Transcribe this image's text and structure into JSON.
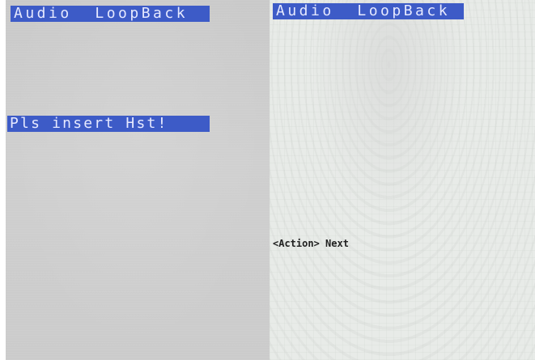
{
  "left_screen": {
    "title": "Audio  LoopBack",
    "prompt": "Pls insert Hst!"
  },
  "right_screen": {
    "title": "Audio  LoopBack",
    "action_hint": "<Action> Next"
  },
  "colors": {
    "highlight_bar": "#3d5bc7",
    "highlight_text": "#e6e9ff",
    "left_background": "#cbcbcb",
    "right_background": "#e8ebe8",
    "body_text": "#222222"
  }
}
